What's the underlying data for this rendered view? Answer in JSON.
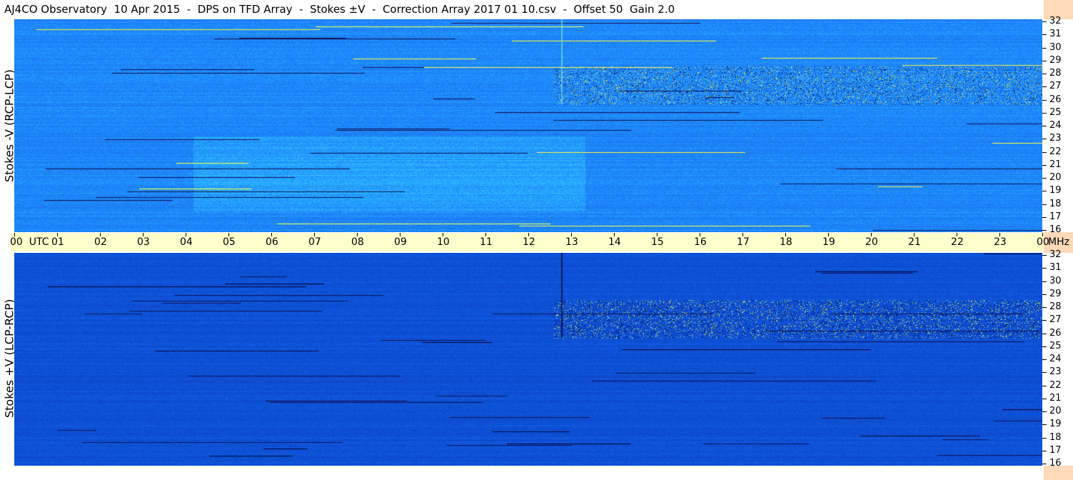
{
  "title": "AJ4CO Observatory  10 Apr 2015  -  DPS on TFD Array  -  Stokes ±V  -  Correction Array 2017 01 10.csv  -  Offset 50  Gain 2.0",
  "chart_data": [
    {
      "type": "heatmap",
      "name": "top",
      "ylabel": "Stokes -V (RCP-LCP)",
      "x_ticks": [
        "00",
        "01",
        "02",
        "03",
        "04",
        "05",
        "06",
        "07",
        "08",
        "09",
        "10",
        "11",
        "12",
        "13",
        "14",
        "15",
        "16",
        "17",
        "18",
        "19",
        "20",
        "21",
        "22",
        "23",
        "00"
      ],
      "x_unit_label": "UTC",
      "y_ticks": [
        16,
        17,
        18,
        19,
        20,
        21,
        22,
        23,
        24,
        25,
        26,
        27,
        28,
        29,
        30,
        31,
        32
      ],
      "ylim": [
        16,
        32
      ],
      "xlim_hours": [
        0,
        24
      ],
      "colormap": "jet",
      "base_colors": [
        "#1565d8",
        "#1e88ff",
        "#30c8ff"
      ]
    },
    {
      "type": "heatmap",
      "name": "bottom",
      "ylabel": "Stokes +V (LCP-RCP)",
      "x_ticks": [
        "00",
        "01",
        "02",
        "03",
        "04",
        "05",
        "06",
        "07",
        "08",
        "09",
        "10",
        "11",
        "12",
        "13",
        "14",
        "15",
        "16",
        "17",
        "18",
        "19",
        "20",
        "21",
        "22",
        "23",
        "00"
      ],
      "y_ticks": [
        16,
        17,
        18,
        19,
        20,
        21,
        22,
        23,
        24,
        25,
        26,
        27,
        28,
        29,
        30,
        31,
        32
      ],
      "ylim": [
        16,
        32
      ],
      "xlim_hours": [
        0,
        24
      ],
      "colormap": "jet",
      "base_colors": [
        "#0a3fc0",
        "#1058e0",
        "#1e88ff"
      ]
    }
  ],
  "x_axis": {
    "unit_right": "MHz"
  },
  "colors": {
    "axis_bg": "#ffffcc",
    "right_edge": "#ffd9b8"
  }
}
